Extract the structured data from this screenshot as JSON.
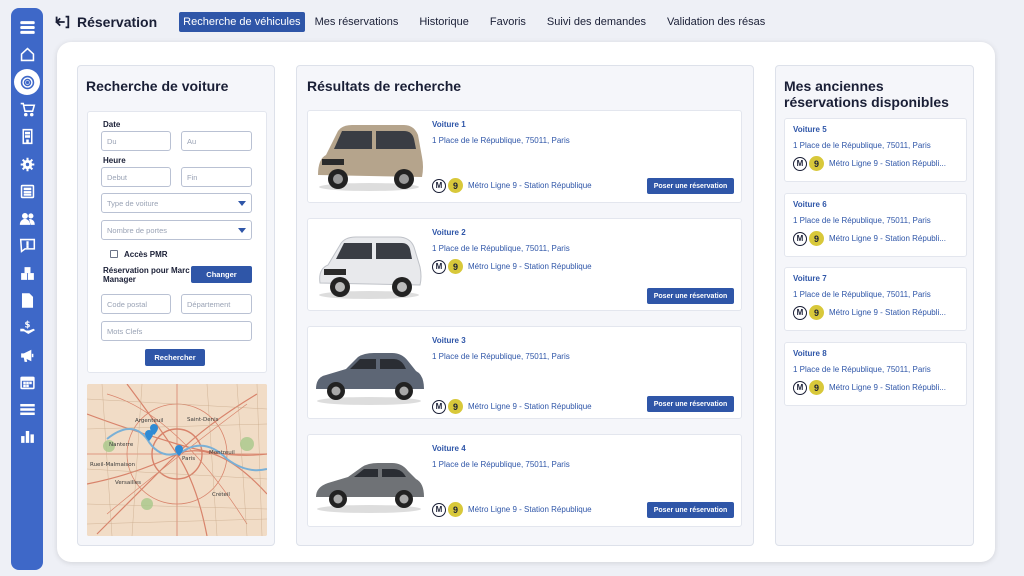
{
  "app": {
    "title": "Réservation"
  },
  "tabs": [
    {
      "label": "Recherche de véhicules",
      "active": true
    },
    {
      "label": "Mes réservations"
    },
    {
      "label": "Historique"
    },
    {
      "label": "Favoris"
    },
    {
      "label": "Suivi des demandes"
    },
    {
      "label": "Validation des résas"
    }
  ],
  "sidebar": {
    "icons": [
      "menu-icon",
      "home-icon",
      "radar-icon",
      "cart-icon",
      "building-icon",
      "gear-icon",
      "newspaper-icon",
      "users-icon",
      "alert-message-icon",
      "boxes-icon",
      "document-icon",
      "hand-money-icon",
      "megaphone-icon",
      "calendar-icon",
      "list-icon",
      "chart-icon"
    ]
  },
  "search": {
    "title": "Recherche de voiture",
    "date_label": "Date",
    "du_placeholder": "Du",
    "au_placeholder": "Au",
    "heure_label": "Heure",
    "debut_placeholder": "Debut",
    "fin_placeholder": "Fin",
    "type_placeholder": "Type de voiture",
    "portes_placeholder": "Nombre de portes",
    "pmr_label": "Accès PMR",
    "reservation_for": "Réservation pour Marc Manager",
    "change_button": "Changer",
    "postal_placeholder": "Code postal",
    "departement_placeholder": "Département",
    "keywords_placeholder": "Mots Clefs",
    "search_button": "Rechercher",
    "map_labels": [
      "Argenteuil",
      "Saint-Denis",
      "Nanterre",
      "Rueil-Malmaison",
      "Paris",
      "Montreuil",
      "Versailles",
      "Créteil"
    ]
  },
  "results": {
    "title": "Résultats de recherche",
    "items": [
      {
        "name": "Voiture  1",
        "address": "1 Place de le République, 75011, Paris",
        "metro_m": "M",
        "metro_line": "9",
        "metro": "Métro Ligne 9 - Station République",
        "button": "Poser une réservation",
        "color": "#b5a48c"
      },
      {
        "name": "Voiture 2",
        "address": "1 Place de le République, 75011, Paris",
        "metro_m": "M",
        "metro_line": "9",
        "metro": "Métro Ligne 9 - Station République",
        "button": "Poser une réservation",
        "color": "#e8e9ec"
      },
      {
        "name": "Voiture 3",
        "address": "1 Place de le République, 75011, Paris",
        "metro_m": "M",
        "metro_line": "9",
        "metro": "Métro Ligne 9 - Station République",
        "button": "Poser une réservation",
        "color": "#5d6675"
      },
      {
        "name": "Voiture 4",
        "address": "1 Place de le République, 75011, Paris",
        "metro_m": "M",
        "metro_line": "9",
        "metro": "Métro Ligne 9 - Station République",
        "button": "Poser une réservation",
        "color": "#6f7276"
      }
    ]
  },
  "old": {
    "title": "Mes anciennes réservations disponibles",
    "items": [
      {
        "name": "Voiture 5",
        "address": "1 Place de le République, 75011, Paris",
        "metro_m": "M",
        "metro_line": "9",
        "metro": "Métro Ligne 9 - Station Républi..."
      },
      {
        "name": "Voiture 6",
        "address": "1 Place de le République, 75011, Paris",
        "metro_m": "M",
        "metro_line": "9",
        "metro": "Métro Ligne 9 - Station Républi..."
      },
      {
        "name": "Voiture 7",
        "address": "1 Place de le République, 75011, Paris",
        "metro_m": "M",
        "metro_line": "9",
        "metro": "Métro Ligne 9 - Station Républi..."
      },
      {
        "name": "Voiture 8",
        "address": "1 Place de le République, 75011, Paris",
        "metro_m": "M",
        "metro_line": "9",
        "metro": "Métro Ligne 9 - Station Républi..."
      }
    ]
  },
  "colors": {
    "accent": "#2f56a8",
    "sidebar": "#3e68c8",
    "metro_line_9": "#d8c83a"
  }
}
